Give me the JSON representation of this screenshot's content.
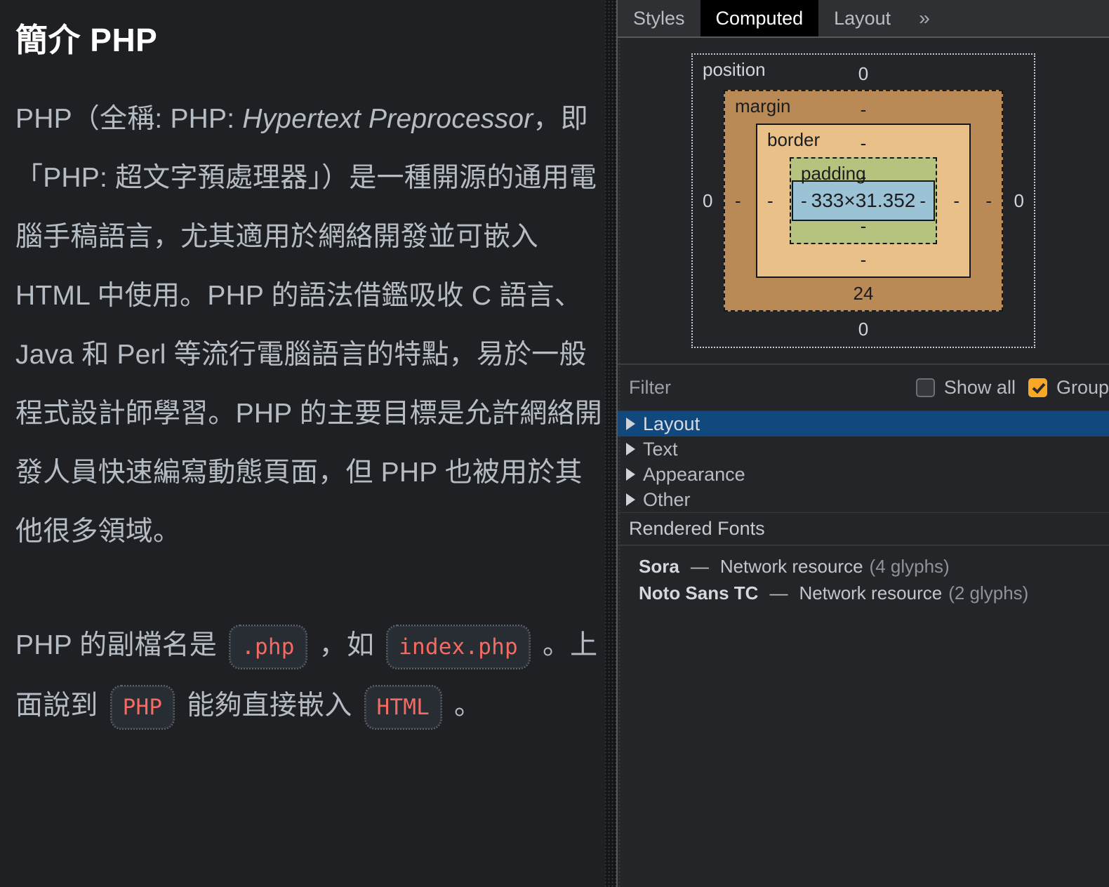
{
  "article": {
    "title": "簡介 PHP",
    "paragraph1_pre": "PHP（全稱: PHP: ",
    "paragraph1_em": "Hypertext Preprocessor",
    "paragraph1_post": "，即「PHP: 超文字預處理器」）是一種開源的通用電腦手稿語言，尤其適用於網絡開發並可嵌入 HTML 中使用。PHP 的語法借鑑吸收 C 語言、Java 和 Perl 等流行電腦語言的特點，易於一般程式設計師學習。PHP 的主要目標是允許網絡開發人員快速編寫動態頁面，但 PHP 也被用於其他很多領域。",
    "paragraph2_a": "PHP 的副檔名是 ",
    "code1": ".php",
    "paragraph2_b": " ，如 ",
    "code2": "index.php",
    "paragraph2_c": " 。上面說到 ",
    "code3": "PHP",
    "paragraph2_d": " 能夠直接嵌入 ",
    "code4": "HTML",
    "paragraph2_e": " 。",
    "code_color": "#f46b63",
    "text_color": "#b6bcc4"
  },
  "devtools": {
    "tabs": [
      {
        "label": "Styles",
        "active": false
      },
      {
        "label": "Computed",
        "active": true
      },
      {
        "label": "Layout",
        "active": false
      }
    ],
    "more_tabs_icon": "»",
    "box_model": {
      "position_label": "position",
      "position_top": "0",
      "position_right": "0",
      "position_bottom": "0",
      "position_left": "0",
      "margin_label": "margin",
      "margin_top": "-",
      "margin_right": "-",
      "margin_bottom": "24",
      "margin_left": "-",
      "border_label": "border",
      "border_top": "-",
      "border_right": "-",
      "border_bottom": "-",
      "border_left": "-",
      "padding_label": "padding",
      "padding_top": "-",
      "padding_right": "-",
      "padding_bottom": "-",
      "padding_left": "-",
      "content_size": "333×31.352",
      "colors": {
        "margin": "#b98a56",
        "border": "#e8c088",
        "padding": "#b6c37e",
        "content": "#9cc3d5"
      }
    },
    "filter": {
      "placeholder": "Filter",
      "value": "",
      "show_all_label": "Show all",
      "show_all_checked": false,
      "group_label": "Group",
      "group_checked": true,
      "accent_color": "#f9a825"
    },
    "property_groups": [
      {
        "label": "Layout",
        "selected": true
      },
      {
        "label": "Text",
        "selected": false
      },
      {
        "label": "Appearance",
        "selected": false
      },
      {
        "label": "Other",
        "selected": false
      }
    ],
    "rendered_fonts": {
      "header": "Rendered Fonts",
      "items": [
        {
          "name": "Sora",
          "dash": "—",
          "source": "Network resource",
          "glyphs": "(4 glyphs)"
        },
        {
          "name": "Noto Sans TC",
          "dash": "—",
          "source": "Network resource",
          "glyphs": "(2 glyphs)"
        }
      ]
    },
    "selection_color": "#11487e"
  }
}
